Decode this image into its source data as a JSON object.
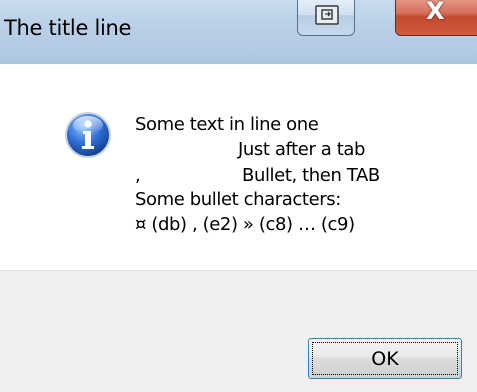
{
  "window": {
    "title": "The title line"
  },
  "titlebar": {
    "restore_icon": "restore-icon",
    "close_glyph": "X"
  },
  "message": {
    "icon": "information-icon",
    "lines": [
      "Some text in line one",
      "Just after a tab",
      ",",
      "Bullet, then TAB",
      "Some bullet characters:",
      "¤ (db) , (e2) » (c8) … (c9)"
    ]
  },
  "buttons": {
    "ok_label": "OK"
  }
}
